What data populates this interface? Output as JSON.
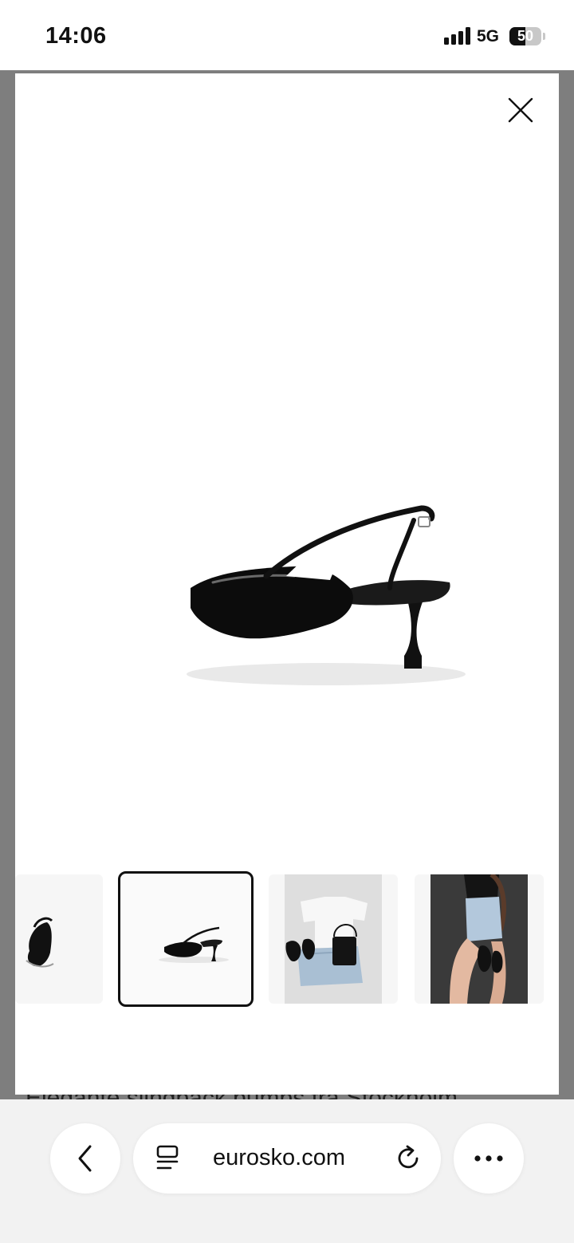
{
  "status_bar": {
    "time": "14:06",
    "network": "5G",
    "battery": "50",
    "battery_level": 0.5
  },
  "page_behind": {
    "text_peek": "Elegante slingback pumps fra Stockholm"
  },
  "gallery": {
    "close_icon": "close-icon",
    "main_image": "black patent slingback pump, rear three-quarter view",
    "thumbnails": [
      {
        "alt": "slingback pump front view",
        "active": false
      },
      {
        "alt": "slingback pump rear view",
        "active": true
      },
      {
        "alt": "flat lay outfit with shorts, t-shirt, bag and pumps",
        "active": false
      },
      {
        "alt": "model holding pumps wearing denim shorts",
        "active": false
      }
    ]
  },
  "browser": {
    "url": "eurosko.com",
    "back_icon": "chevron-left-icon",
    "tabs_icon": "reader-icon",
    "reload_icon": "reload-icon",
    "more_icon": "more-icon"
  },
  "colors": {
    "backdrop": "#7e7e7e",
    "active_border": "#111111",
    "browser_bar": "#f2f2f2"
  }
}
